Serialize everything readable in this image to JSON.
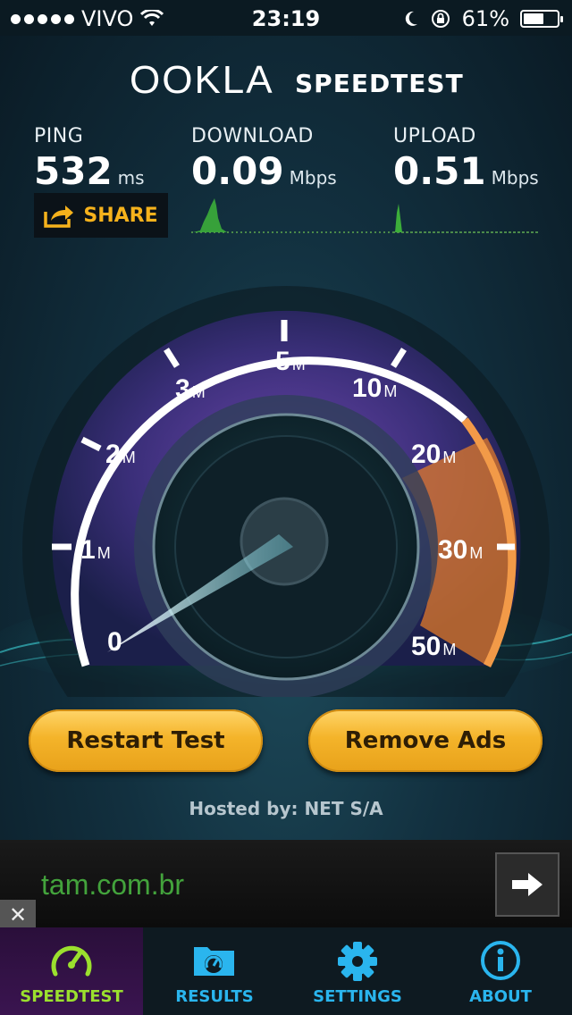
{
  "status_bar": {
    "carrier": "VIVO",
    "time": "23:19",
    "battery_text": "61%",
    "battery_level": 0.61,
    "icons": [
      "signal-dots",
      "wifi-icon",
      "moon-icon",
      "rotation-lock-icon",
      "battery-icon"
    ]
  },
  "header": {
    "logo": "OOKLA",
    "title": "SPEEDTEST"
  },
  "stats": {
    "ping": {
      "label": "PING",
      "value": "532",
      "unit": "ms"
    },
    "download": {
      "label": "DOWNLOAD",
      "value": "0.09",
      "unit": "Mbps"
    },
    "upload": {
      "label": "UPLOAD",
      "value": "0.51",
      "unit": "Mbps"
    }
  },
  "share": {
    "label": "SHARE"
  },
  "gauge": {
    "scale": [
      {
        "num": "0",
        "unit": ""
      },
      {
        "num": "1",
        "unit": "M"
      },
      {
        "num": "2",
        "unit": "M"
      },
      {
        "num": "3",
        "unit": "M"
      },
      {
        "num": "5",
        "unit": "M"
      },
      {
        "num": "10",
        "unit": "M"
      },
      {
        "num": "20",
        "unit": "M"
      },
      {
        "num": "30",
        "unit": "M"
      },
      {
        "num": "50",
        "unit": "M"
      }
    ]
  },
  "buttons": {
    "restart": "Restart Test",
    "remove_ads": "Remove Ads"
  },
  "hosted_by": "Hosted by: NET S/A",
  "ad": {
    "text": "tam.com.br"
  },
  "tabs": [
    {
      "label": "SPEEDTEST",
      "icon": "speedometer-icon",
      "active": true
    },
    {
      "label": "RESULTS",
      "icon": "results-folder-icon",
      "active": false
    },
    {
      "label": "SETTINGS",
      "icon": "gear-icon",
      "active": false
    },
    {
      "label": "ABOUT",
      "icon": "info-icon",
      "active": false
    }
  ],
  "colors": {
    "accent_orange": "#f6b21c",
    "tab_active_green": "#9be02e",
    "tab_blue": "#2ab5ee",
    "ad_green": "#43a33c"
  }
}
